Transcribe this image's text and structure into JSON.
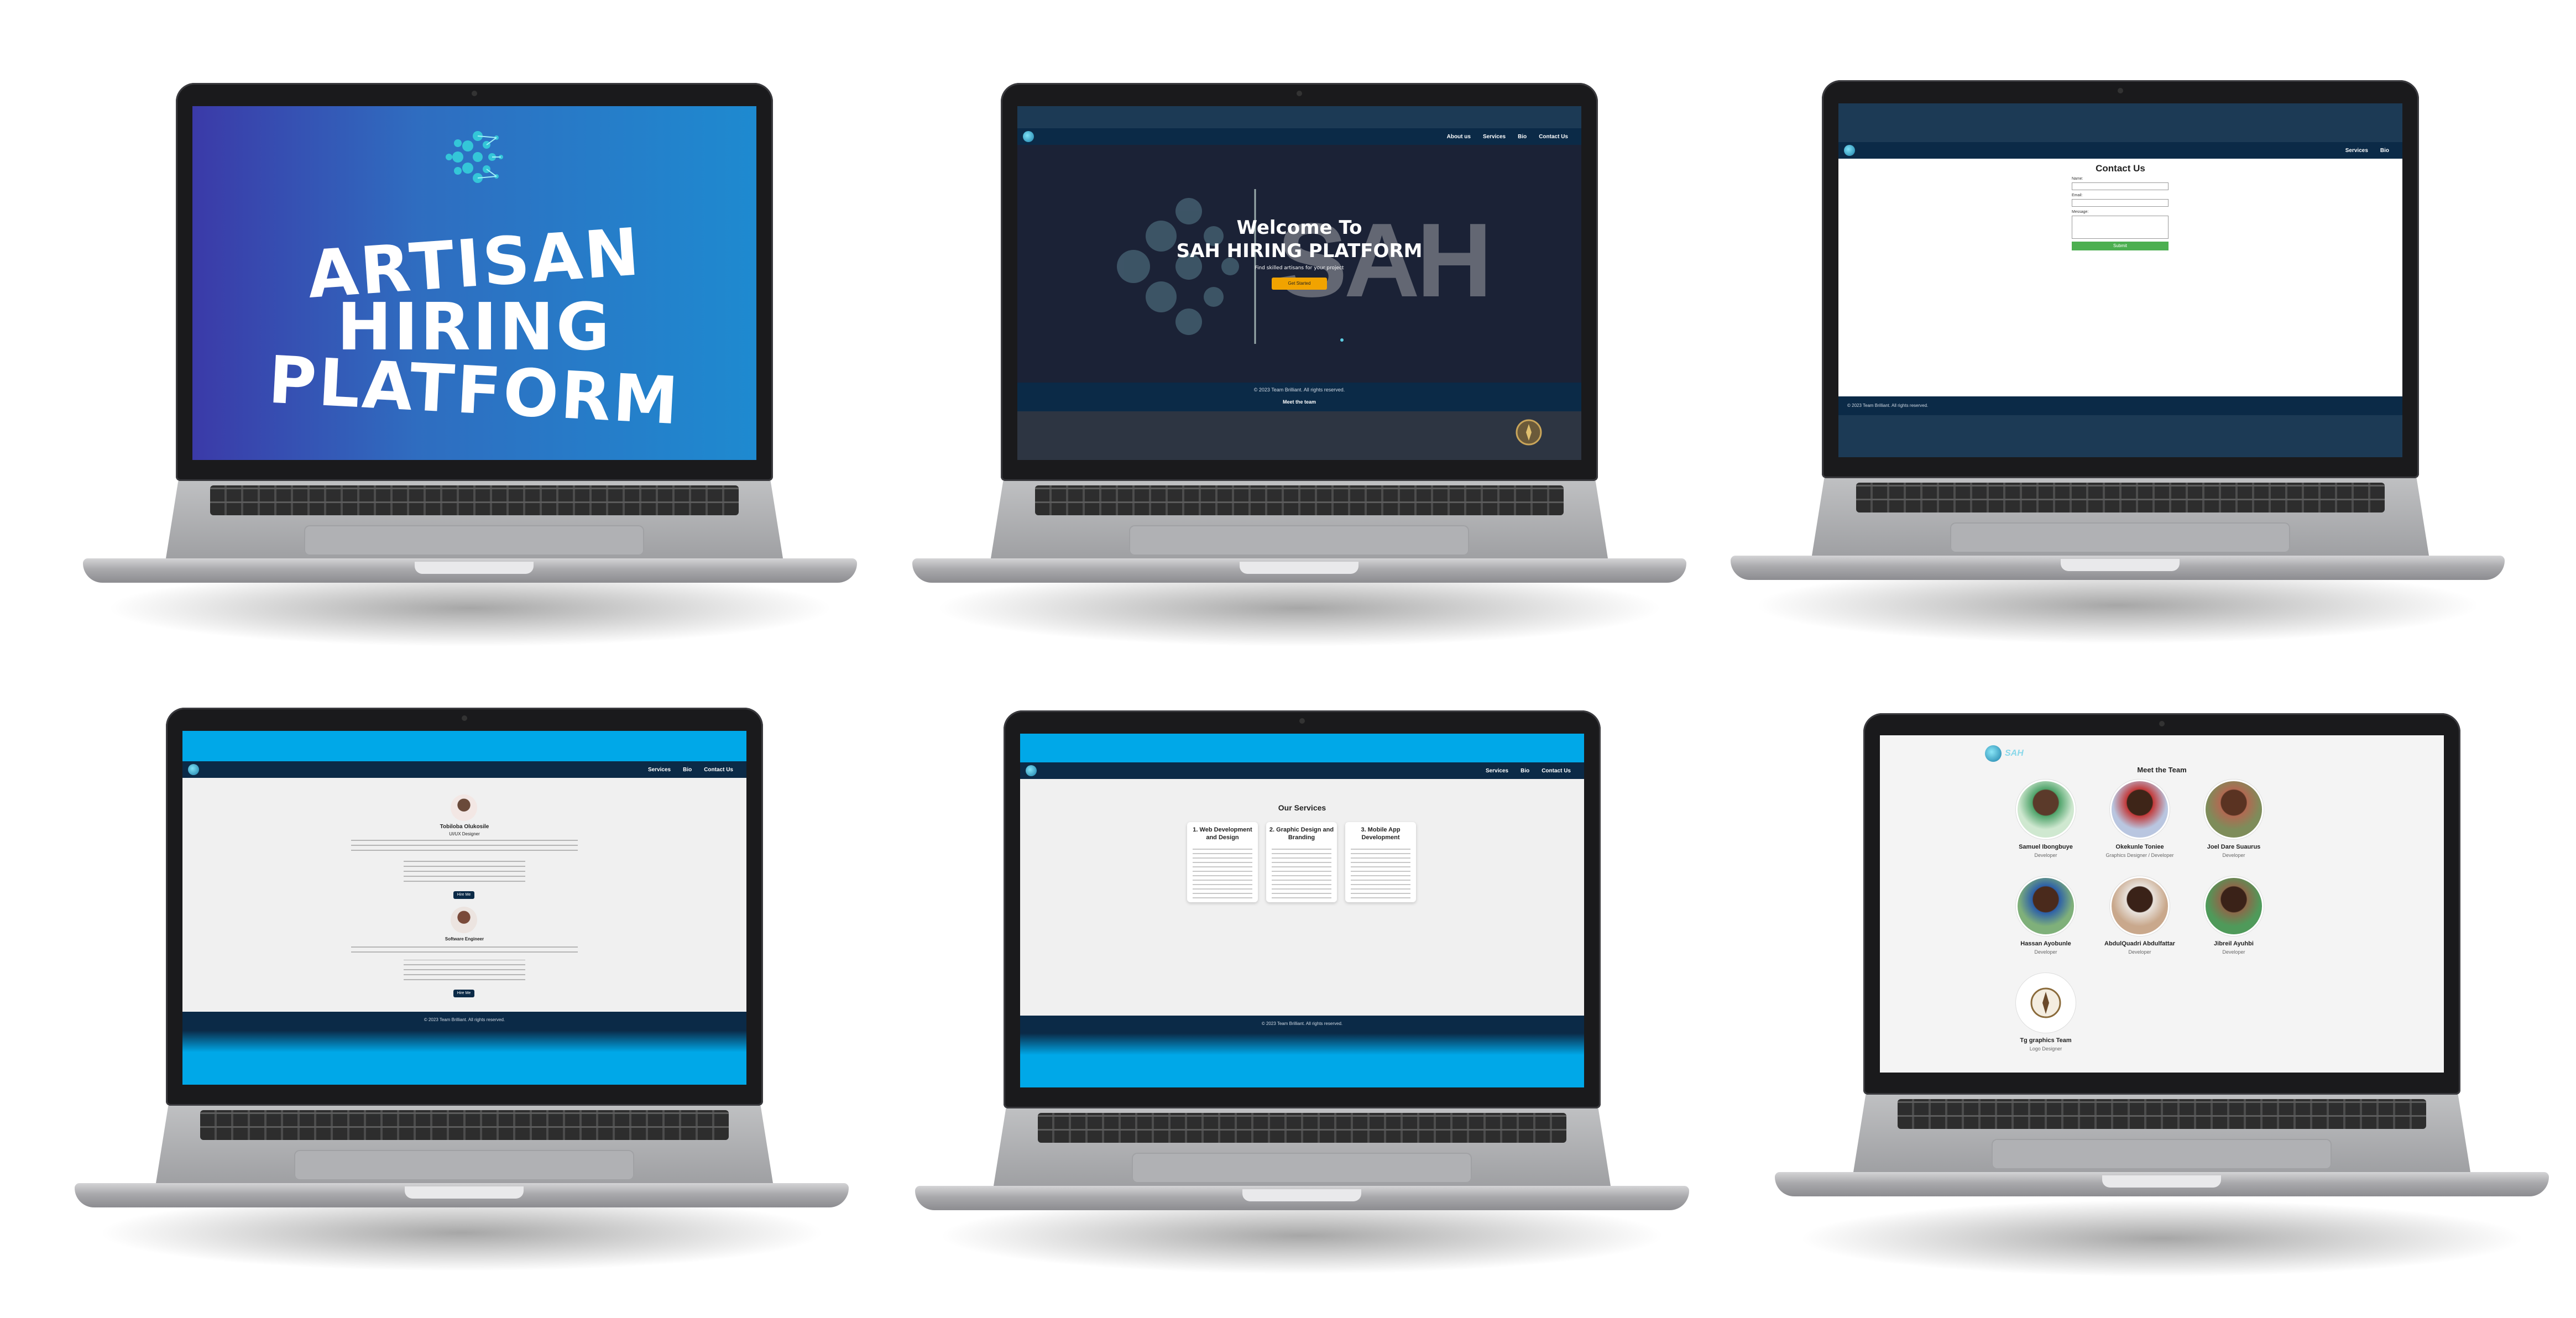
{
  "screen1": {
    "title_lines": [
      "ARTISAN",
      "HIRING",
      "PLATFORM"
    ]
  },
  "screen2": {
    "nav": [
      "About us",
      "Services",
      "Bio",
      "Contact Us"
    ],
    "welcome_line1": "Welcome To",
    "welcome_line2": "SAH HIRING PLATFORM",
    "subtitle": "Find skilled artisans for your project",
    "cta": "Get Started",
    "bg_letters": "SAH",
    "footer_copyright": "© 2023 Team Brilliant. All rights reserved.",
    "footer_link": "Meet the team"
  },
  "screen3": {
    "nav": [
      "Services",
      "Bio"
    ],
    "heading": "Contact Us",
    "name_label": "Name:",
    "email_label": "Email:",
    "message_label": "Message:",
    "submit": "Submit",
    "footer": "© 2023 Team Brilliant. All rights reserved."
  },
  "screen4": {
    "nav": [
      "Services",
      "Bio",
      "Contact Us"
    ],
    "person1_name": "Tobiloba Olukosile",
    "person1_role": "UI/UX Designer",
    "person2_role": "Software Engineer",
    "hire_button": "Hire Me",
    "footer": "© 2023 Team Brilliant. All rights reserved."
  },
  "screen5": {
    "nav": [
      "Services",
      "Bio",
      "Contact Us"
    ],
    "heading": "Our Services",
    "services": [
      {
        "title": "1. Web Development and Design"
      },
      {
        "title": "2. Graphic Design and Branding"
      },
      {
        "title": "3. Mobile App Development"
      }
    ],
    "footer": "© 2023 Team Brilliant. All rights reserved."
  },
  "screen6": {
    "logo_text": "SAH",
    "heading": "Meet the Team",
    "members": [
      {
        "name": "Samuel Ibongbuye",
        "role": "Developer"
      },
      {
        "name": "Okekunle Toniee",
        "role": "Graphics Designer / Developer"
      },
      {
        "name": "Joel Dare Suaurus",
        "role": "Developer"
      },
      {
        "name": "Hassan Ayobunle",
        "role": "Developer"
      },
      {
        "name": "AbdulQuadri Abdulfattar",
        "role": "Developer"
      },
      {
        "name": "Jibreil Ayuhbi",
        "role": "Developer"
      },
      {
        "name": "Tg graphics Team",
        "role": "Logo Designer"
      }
    ]
  },
  "colors": {
    "navy": "#0b2a47",
    "cyan": "#00a8e8",
    "yellow": "#f1a300",
    "green": "#4caf50"
  }
}
